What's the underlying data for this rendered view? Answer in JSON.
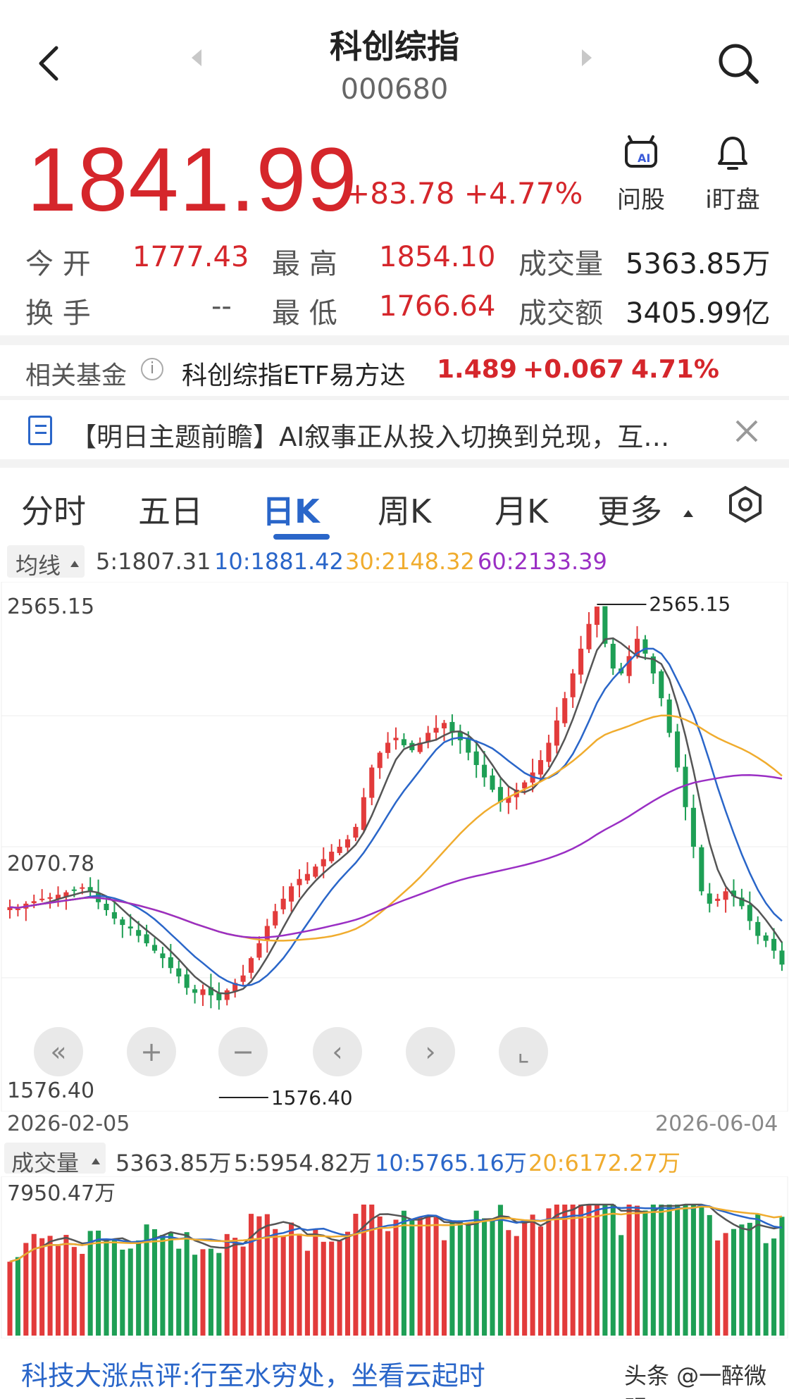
{
  "header": {
    "title": "科创综指",
    "code": "000680"
  },
  "quote": {
    "price": "1841.99",
    "change": "+83.78",
    "change_pct": "+4.77%",
    "ai_stock_label": "问股",
    "watch_label": "i盯盘"
  },
  "stats": {
    "open_label": "今  开",
    "open": "1777.43",
    "high_label": "最  高",
    "high": "1854.10",
    "volume_label": "成交量",
    "volume": "5363.85万",
    "turnover_label": "换  手",
    "turnover": "--",
    "low_label": "最  低",
    "low": "1766.64",
    "amount_label": "成交额",
    "amount": "3405.99亿"
  },
  "fund": {
    "label": "相关基金",
    "hint_icon": "i",
    "name": "科创综指ETF易方达",
    "price": "1.489",
    "change": "+0.067",
    "change_pct": "4.71%"
  },
  "news": {
    "text": "【明日主题前瞻】AI叙事正从投入切换到兑现，互…"
  },
  "tabs": [
    "分时",
    "五日",
    "日K",
    "周K",
    "月K",
    "更多"
  ],
  "ma": {
    "button": "均线",
    "ma5": "5:1807.31",
    "ma10": "10:1881.42",
    "ma30": "30:2148.32",
    "ma60": "60:2133.39"
  },
  "colors": {
    "up": "#e23b3b",
    "down": "#1e9f55",
    "ma5": "#555555",
    "ma10": "#2a66c9",
    "ma30": "#f0ac2e",
    "ma60": "#9a2fc4"
  },
  "chart_data": {
    "type": "candlestick",
    "y_labels": [
      "2565.15",
      "2070.78",
      "1576.40"
    ],
    "ylim": [
      1576.4,
      2565.15
    ],
    "high_marker": "2565.15",
    "low_marker": "1576.40",
    "start_date": "2026-02-05",
    "end_date": "2026-06-04",
    "close": [
      1958,
      1955,
      1965,
      1970,
      1975,
      1978,
      1983,
      1988,
      1992,
      1998,
      1990,
      1968,
      1952,
      1935,
      1922,
      1915,
      1900,
      1885,
      1870,
      1855,
      1835,
      1818,
      1795,
      1785,
      1792,
      1780,
      1770,
      1790,
      1805,
      1820,
      1855,
      1885,
      1920,
      1950,
      1975,
      2000,
      2015,
      2025,
      2040,
      2055,
      2070,
      2080,
      2095,
      2120,
      2180,
      2240,
      2270,
      2290,
      2300,
      2285,
      2275,
      2290,
      2310,
      2320,
      2330,
      2310,
      2295,
      2270,
      2245,
      2220,
      2195,
      2170,
      2180,
      2195,
      2210,
      2230,
      2255,
      2290,
      2335,
      2380,
      2430,
      2480,
      2530,
      2565,
      2490,
      2440,
      2430,
      2465,
      2500,
      2470,
      2430,
      2380,
      2310,
      2240,
      2160,
      2080,
      1990,
      1965,
      1975,
      1990,
      1980,
      1960,
      1930,
      1900,
      1890,
      1870,
      1842
    ],
    "ma_values": {
      "ma5": "1807.31",
      "ma10": "1881.42",
      "ma30": "2148.32",
      "ma60": "2133.39"
    }
  },
  "volume": {
    "button": "成交量",
    "current": "5363.85万",
    "ma5": "5:5954.82万",
    "ma10": "10:5765.16万",
    "ma20": "20:6172.27万",
    "max_label": "7950.47万"
  },
  "bottom": {
    "news": "科技大涨点评:行至水穷处，坐看云起时",
    "watermark": "头条 @一醉微明"
  },
  "icons": {
    "back": "back-arrow-icon",
    "search": "search-icon",
    "close": "close-icon",
    "settings": "hexagon-settings-icon"
  }
}
